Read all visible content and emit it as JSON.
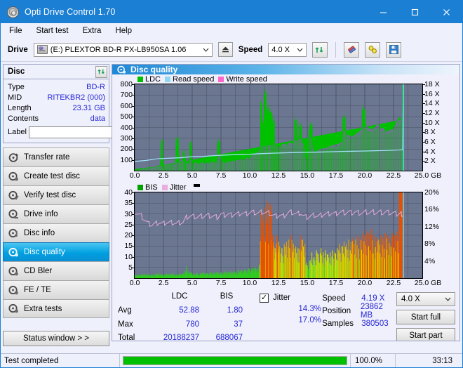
{
  "window": {
    "title": "Opti Drive Control 1.70",
    "icon": "disc-icon",
    "minimize": "minimize",
    "maximize": "maximize",
    "close": "close"
  },
  "menu": [
    "File",
    "Start test",
    "Extra",
    "Help"
  ],
  "toolbar": {
    "drive_label": "Drive",
    "drive_value": "(E:)   PLEXTOR BD-R  PX-LB950SA 1.06",
    "eject_title": "Eject",
    "speed_label": "Speed",
    "speed_value": "4.0 X",
    "refresh_icon": "refresh-icon",
    "erase_icon": "eraser-icon",
    "settings_icon": "settings-icon",
    "save_icon": "save-icon"
  },
  "disc": {
    "header": "Disc",
    "refresh_icon": "refresh-icon",
    "rows": [
      {
        "key": "Type",
        "value": "BD-R"
      },
      {
        "key": "MID",
        "value": "RITEKBR2 (000)"
      },
      {
        "key": "Length",
        "value": "23.31 GB"
      },
      {
        "key": "Contents",
        "value": "data"
      }
    ],
    "label_key": "Label",
    "label_value": "",
    "label_icon": "disc-icon"
  },
  "nav": {
    "items": [
      {
        "label": "Transfer rate",
        "selected": false
      },
      {
        "label": "Create test disc",
        "selected": false
      },
      {
        "label": "Verify test disc",
        "selected": false
      },
      {
        "label": "Drive info",
        "selected": false
      },
      {
        "label": "Disc info",
        "selected": false
      },
      {
        "label": "Disc quality",
        "selected": true
      },
      {
        "label": "CD Bler",
        "selected": false
      },
      {
        "label": "FE / TE",
        "selected": false
      },
      {
        "label": "Extra tests",
        "selected": false
      }
    ],
    "status_button": "Status window > >"
  },
  "main": {
    "title": "Disc quality",
    "title_icon": "disc-quality-icon"
  },
  "chart_data": [
    {
      "type": "area",
      "title": "Disc quality - LDC / speed",
      "xlabel": "GB",
      "ylabel": "LDC",
      "xlim": [
        0.0,
        25.0
      ],
      "ylim": [
        0,
        800
      ],
      "y2lim": [
        0,
        18
      ],
      "y2label": "X",
      "grid": true,
      "legend_position": "top-left",
      "legend": [
        {
          "name": "LDC",
          "color": "#00C000"
        },
        {
          "name": "Read speed",
          "color": "#8FD8F0"
        },
        {
          "name": "Write speed",
          "color": "#FF66CC"
        }
      ],
      "xticks": [
        "0.0",
        "2.5",
        "5.0",
        "7.5",
        "10.0",
        "12.5",
        "15.0",
        "17.5",
        "20.0",
        "22.5",
        "25.0"
      ],
      "yticks": [
        100,
        200,
        300,
        400,
        500,
        600,
        700,
        800
      ],
      "y2ticks": [
        "2 X",
        "4 X",
        "6 X",
        "8 X",
        "10 X",
        "12 X",
        "14 X",
        "16 X",
        "18 X"
      ],
      "series": [
        {
          "name": "LDC",
          "color": "#00C000",
          "x": [
            0.0,
            0.2,
            0.4,
            0.6,
            0.8,
            1.0,
            1.2,
            1.4,
            1.6,
            1.8,
            2.0,
            2.2,
            2.4,
            2.45,
            2.5,
            2.7,
            2.9,
            3.1,
            3.3,
            3.5,
            3.7,
            3.9,
            4.1,
            4.3,
            4.35,
            4.5,
            4.7,
            4.9,
            5.0,
            5.1,
            5.3,
            5.5,
            5.7,
            5.9,
            6.1,
            6.3,
            6.5,
            6.7,
            6.9,
            7.1,
            7.3,
            7.5,
            7.6,
            7.7,
            7.9,
            8.1,
            8.3,
            8.5,
            8.7,
            8.9,
            9.1,
            9.3,
            9.5,
            9.7,
            9.9,
            10.1,
            10.3,
            10.5,
            10.7,
            10.9,
            11.0,
            11.1,
            11.2,
            11.35,
            11.5,
            11.6,
            11.75,
            11.9,
            12.0,
            12.1,
            12.2,
            12.3,
            12.4,
            12.5,
            12.6,
            12.8,
            13.0,
            13.2,
            13.4,
            13.6,
            13.8,
            14.0,
            14.2,
            14.4,
            14.6,
            14.7,
            14.9,
            15.0,
            15.1,
            15.2,
            15.35,
            15.5,
            15.7,
            15.9,
            16.0,
            16.2,
            16.4,
            16.6,
            16.8,
            17.0,
            17.2,
            17.4,
            17.6,
            17.8,
            18.0,
            18.2,
            18.4,
            18.5,
            18.7,
            18.9,
            19.1,
            19.3,
            19.5,
            19.7,
            19.9,
            20.1,
            20.3,
            20.4,
            20.6,
            20.8,
            21.0,
            21.2,
            21.4,
            21.6,
            21.8,
            22.0,
            22.2,
            22.4,
            22.6,
            22.8,
            23.0,
            23.2,
            23.35
          ],
          "y": [
            12,
            20,
            15,
            25,
            18,
            30,
            22,
            35,
            28,
            40,
            30,
            55,
            310,
            120,
            45,
            60,
            50,
            70,
            55,
            60,
            330,
            90,
            65,
            200,
            140,
            70,
            60,
            290,
            75,
            60,
            80,
            65,
            70,
            80,
            65,
            75,
            70,
            85,
            75,
            70,
            300,
            95,
            75,
            80,
            70,
            90,
            80,
            95,
            85,
            100,
            95,
            110,
            100,
            120,
            110,
            130,
            150,
            160,
            170,
            200,
            690,
            430,
            470,
            780,
            520,
            620,
            530,
            560,
            430,
            505,
            250,
            225,
            215,
            230,
            210,
            240,
            250,
            235,
            260,
            255,
            245,
            510,
            270,
            455,
            250,
            240,
            90,
            120,
            160,
            410,
            460,
            210,
            175,
            185,
            195,
            200,
            210,
            205,
            215,
            230,
            235,
            240,
            245,
            250,
            265,
            540,
            300,
            340,
            320,
            315,
            330,
            345,
            360,
            380,
            620,
            415,
            400,
            390,
            385,
            395,
            420,
            430,
            390,
            400,
            360,
            370,
            375,
            385,
            420,
            460,
            495,
            470
          ]
        },
        {
          "name": "Read speed",
          "color": "#8FD8F0",
          "x": [
            0.0,
            1.0,
            2.0,
            3.0,
            4.0,
            5.0,
            6.0,
            7.0,
            8.0,
            9.0,
            10.0,
            11.0,
            12.0,
            13.0,
            14.0,
            15.0,
            16.0,
            17.0,
            18.0,
            19.0,
            20.0,
            21.0,
            22.0,
            23.0,
            23.3,
            23.35
          ],
          "y": [
            85,
            95,
            110,
            115,
            120,
            130,
            132,
            140,
            145,
            150,
            152,
            158,
            162,
            165,
            168,
            170,
            172,
            175,
            178,
            180,
            182,
            185,
            188,
            192,
            195,
            800
          ]
        }
      ]
    },
    {
      "type": "area",
      "title": "Disc quality - BIS / jitter",
      "xlabel": "GB",
      "ylabel": "BIS",
      "xlim": [
        0.0,
        25.0
      ],
      "ylim": [
        0,
        40
      ],
      "y2lim": [
        0,
        20
      ],
      "y2label": "%",
      "grid": true,
      "legend_position": "top-left",
      "legend": [
        {
          "name": "BIS",
          "color": "#00A000"
        },
        {
          "name": "Jitter",
          "color": "#E8AEE0"
        }
      ],
      "xticks": [
        "0.0",
        "2.5",
        "5.0",
        "7.5",
        "10.0",
        "12.5",
        "15.0",
        "17.5",
        "20.0",
        "22.5",
        "25.0"
      ],
      "yticks": [
        5,
        10,
        15,
        20,
        25,
        30,
        35,
        40
      ],
      "y2ticks": [
        "4%",
        "8%",
        "12%",
        "16%",
        "20%"
      ],
      "series": [
        {
          "name": "BIS",
          "color": "gradient-green-yellow-orange",
          "x": [
            0.0,
            0.3,
            0.6,
            0.9,
            1.2,
            1.5,
            1.8,
            2.1,
            2.4,
            2.7,
            3.0,
            3.3,
            3.6,
            3.9,
            4.2,
            4.5,
            4.8,
            4.9,
            5.1,
            5.4,
            5.7,
            6.0,
            6.3,
            6.6,
            6.9,
            7.2,
            7.5,
            7.8,
            8.1,
            8.4,
            8.7,
            9.0,
            9.3,
            9.6,
            9.9,
            10.2,
            10.5,
            10.8,
            11.0,
            11.1,
            11.3,
            11.5,
            11.7,
            11.8,
            11.9,
            12.0,
            12.1,
            12.2,
            12.3,
            12.4,
            12.5,
            12.6,
            12.8,
            13.0,
            13.2,
            13.4,
            13.6,
            13.8,
            14.0,
            14.2,
            14.4,
            14.6,
            14.8,
            15.0,
            15.2,
            15.4,
            15.6,
            15.8,
            16.0,
            16.2,
            16.4,
            16.6,
            16.8,
            17.0,
            17.2,
            17.4,
            17.6,
            17.8,
            18.0,
            18.2,
            18.4,
            18.6,
            18.8,
            19.0,
            19.2,
            19.4,
            19.6,
            19.8,
            20.0,
            20.2,
            20.4,
            20.6,
            20.8,
            21.0,
            21.2,
            21.4,
            21.6,
            21.8,
            22.0,
            22.2,
            22.4,
            22.6,
            22.8,
            23.0,
            23.2,
            23.35
          ],
          "y": [
            2,
            1.5,
            2,
            1.8,
            2.2,
            1.6,
            2,
            2.5,
            1.8,
            2.2,
            2,
            2.4,
            1.8,
            2.2,
            2,
            5.5,
            2.5,
            3,
            2.2,
            2.6,
            2.2,
            2.8,
            2.4,
            2.8,
            2.6,
            3.0,
            2.8,
            3.2,
            3.0,
            3.4,
            3.2,
            3.8,
            3.6,
            4.2,
            4.6,
            4.8,
            5.0,
            5.2,
            32,
            30,
            33,
            36,
            35,
            34,
            31,
            20,
            15,
            14,
            16,
            20,
            17,
            15,
            14,
            16,
            17,
            18,
            20,
            16,
            15,
            14,
            20,
            18,
            16,
            6,
            8,
            12,
            10,
            13,
            11,
            14,
            12,
            13,
            11,
            12,
            13,
            12,
            14,
            16,
            15,
            17,
            16,
            18,
            17,
            19,
            18,
            20,
            19,
            21,
            20,
            22,
            21,
            23,
            20,
            19,
            18,
            20,
            19,
            21,
            20,
            19,
            21,
            20,
            22,
            21
          ]
        },
        {
          "name": "Jitter",
          "color": "#E8AEE0",
          "x": [
            0.0,
            0.3,
            0.6,
            0.9,
            1.2,
            1.5,
            1.8,
            2.1,
            2.4,
            2.7,
            3.0,
            3.3,
            3.6,
            3.9,
            4.2,
            4.5,
            4.8,
            5.1,
            5.4,
            5.7,
            6.0,
            6.3,
            6.6,
            6.9,
            7.2,
            7.5,
            7.8,
            8.1,
            8.4,
            8.7,
            9.0,
            9.3,
            9.6,
            9.9,
            10.2,
            10.5,
            10.8,
            11.1,
            11.4,
            11.7,
            12.0,
            12.3,
            12.6,
            12.9,
            13.2,
            13.5,
            13.8,
            14.1,
            14.4,
            14.7,
            15.0,
            15.3,
            15.6,
            15.9,
            16.2,
            16.5,
            16.8,
            17.1,
            17.4,
            17.7,
            18.0,
            18.3,
            18.6,
            18.9,
            19.2,
            19.5,
            19.8,
            20.1,
            20.4,
            20.7,
            21.0,
            21.3,
            21.6,
            21.9,
            22.2,
            22.5,
            22.8,
            23.0,
            23.2,
            23.35
          ],
          "y": [
            31,
            30,
            29,
            27,
            25.5,
            25,
            25.5,
            26,
            25.5,
            26,
            26,
            26,
            25.5,
            26,
            26,
            28.5,
            29,
            29,
            28.5,
            29,
            29,
            29.5,
            29,
            29,
            28.5,
            30,
            29.5,
            30,
            29.5,
            30,
            30,
            30.5,
            30,
            30.5,
            31,
            30.5,
            30.5,
            31,
            30.5,
            30.5,
            29.5,
            29,
            29.5,
            29,
            30,
            31,
            30.5,
            30,
            30.5,
            29,
            28.5,
            29,
            29.5,
            29,
            29.5,
            30,
            30,
            30.5,
            30,
            30.5,
            31,
            30.5,
            31,
            30.5,
            31,
            30.5,
            30.5,
            31,
            30.5,
            31,
            30.5,
            31,
            30.5,
            31,
            30.5,
            30.5,
            30,
            30,
            30,
            29
          ]
        }
      ]
    }
  ],
  "stats": {
    "columns": [
      "LDC",
      "BIS"
    ],
    "rows": [
      {
        "label": "Avg",
        "ldc": "52.88",
        "bis": "1.80",
        "jitter": "14.3%"
      },
      {
        "label": "Max",
        "ldc": "780",
        "bis": "37",
        "jitter": "17.0%"
      },
      {
        "label": "Total",
        "ldc": "20188237",
        "bis": "688067",
        "jitter": ""
      }
    ],
    "jitter_label": "Jitter",
    "jitter_checked": true,
    "speed_label": "Speed",
    "speed_value": "4.19 X",
    "position_label": "Position",
    "position_value": "23862 MB",
    "samples_label": "Samples",
    "samples_value": "380503",
    "speed_select": "4.0 X",
    "start_full": "Start full",
    "start_part": "Start part"
  },
  "statusbar": {
    "message": "Test completed",
    "progress_percent": "100.0%",
    "progress_value": 100,
    "elapsed": "33:13"
  }
}
